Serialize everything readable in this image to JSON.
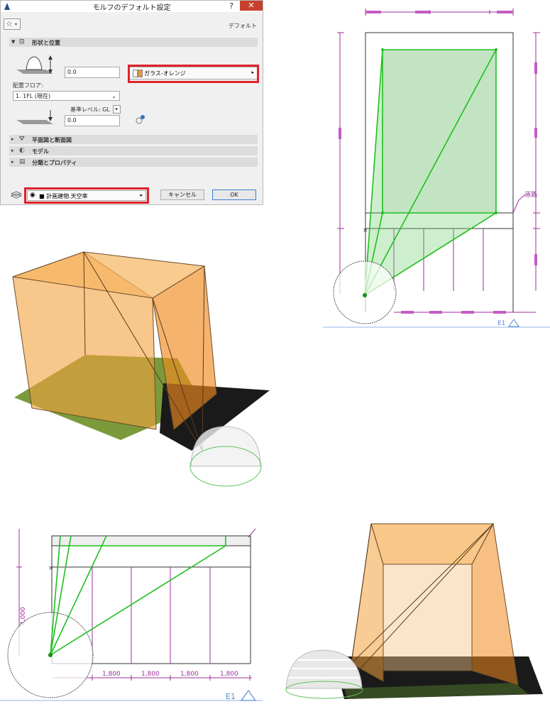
{
  "dialog": {
    "title": "モルフのデフォルト設定",
    "help": "?",
    "close": "✕",
    "default_label": "デフォルト",
    "sections": {
      "shape": "形状と位置",
      "plan": "平面図と断面図",
      "model": "モデル",
      "class": "分類とプロパティ"
    },
    "height_value": "0.0",
    "floor_label": "配置フロア:",
    "floor_value": "1. 1FL (現在)",
    "ref_level": "基準レベル: GL",
    "elev_value": "0.0",
    "material": "ガラス-オレンジ",
    "layer": "■ 計画建物.天空率",
    "cancel": "キャンセル",
    "ok": "OK"
  },
  "plan_top": {
    "label_right": "道路",
    "elev_marker": "E1"
  },
  "plan_detail": {
    "dim_vertical": "4,000",
    "dims_bottom": [
      "1,800",
      "1,800",
      "1,800",
      "1,800"
    ],
    "elev_marker": "E1"
  },
  "colors": {
    "highlight": "#e0222c",
    "green_line": "#1fbf1f",
    "dimension": "#9b2f9b",
    "orange_glass": "#f3a23e"
  }
}
